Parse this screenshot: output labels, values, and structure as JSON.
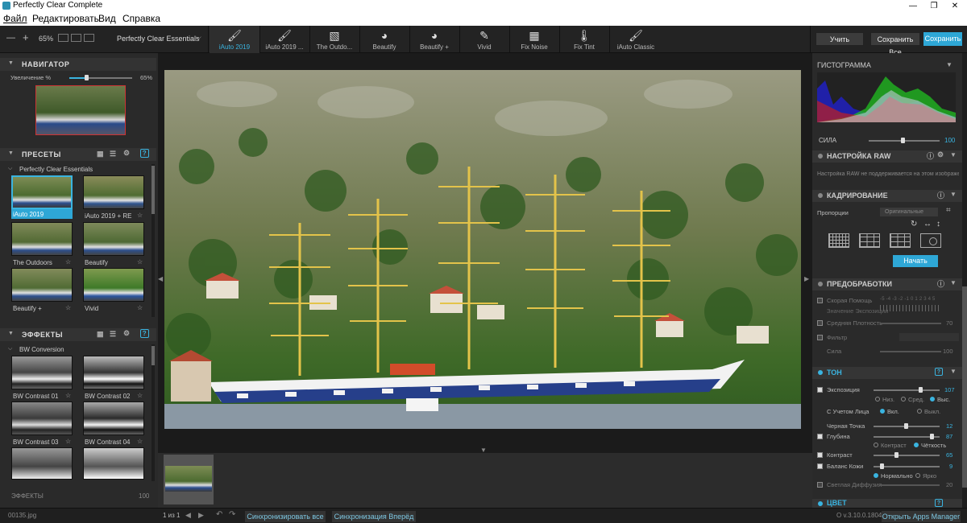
{
  "window": {
    "title": "Perfectly Clear Complete",
    "minimize": "—",
    "maximize": "❐",
    "close": "✕"
  },
  "menu": [
    {
      "label": "Файл"
    },
    {
      "label": "Редактировать"
    },
    {
      "label": "Вид"
    },
    {
      "label": "Справка"
    }
  ],
  "toolbar": {
    "zoom": "65%",
    "minus": "—",
    "plus": "+",
    "preset_selector": "Perfectly Clear Essentials",
    "presets": [
      {
        "label": "iAuto 2019",
        "badge": "2019",
        "active": true
      },
      {
        "label": "iAuto 2019 ...",
        "badge": "2019",
        "active": false
      },
      {
        "label": "The Outdo...",
        "badge": "",
        "active": false
      },
      {
        "label": "Beautify",
        "badge": "",
        "active": false
      },
      {
        "label": "Beautify +",
        "badge": "",
        "active": false
      },
      {
        "label": "Vivid",
        "badge": "",
        "active": false
      },
      {
        "label": "Fix Noise",
        "badge": "",
        "active": false
      },
      {
        "label": "Fix Tint",
        "badge": "",
        "active": false
      },
      {
        "label": "iAuto Classic",
        "badge": "HD",
        "active": false
      }
    ],
    "apply": "Учить",
    "save_all": "Сохранить Все",
    "save": "Сохранить"
  },
  "navigator": {
    "title": "НАВИГАТОР",
    "zoom_label": "Увеличение %",
    "zoom_value": "65%",
    "zoom_level": 0.27
  },
  "presets_panel": {
    "title": "ПРЕСЕТЫ",
    "group": "Perfectly Clear Essentials",
    "items": [
      {
        "label": "iAuto 2019",
        "selected": true
      },
      {
        "label": "iAuto 2019 + RE",
        "selected": false
      },
      {
        "label": "The Outdoors",
        "selected": false
      },
      {
        "label": "Beautify",
        "selected": false
      },
      {
        "label": "Beautify +",
        "selected": false
      },
      {
        "label": "Vivid",
        "selected": false
      }
    ]
  },
  "effects_panel": {
    "title": "ЭФФЕКТЫ",
    "group": "BW Conversion",
    "items": [
      {
        "label": "BW Contrast 01"
      },
      {
        "label": "BW Contrast 02"
      },
      {
        "label": "BW Contrast 03"
      },
      {
        "label": "BW Contrast 04"
      }
    ],
    "footer_label": "ЭФФЕКТЫ",
    "footer_value": "100"
  },
  "right": {
    "histogram_title": "ГИСТОГРАММА",
    "strength_label": "СИЛА",
    "strength_value": "100",
    "raw": {
      "title": "НАСТРОЙКА RAW",
      "message": "Настройка RAW не поддерживается на этом изображени..."
    },
    "crop": {
      "title": "КАДРИРОВАНИЕ",
      "proportions_label": "Пропорции",
      "proportions_value": "Оригинальные",
      "start": "Начать"
    },
    "preprocessing": {
      "title": "ПРЕДОБРАБОТКИ",
      "quick_help": "Скорая Помощь",
      "exposure_value_label": "Значение Экспозиции",
      "scale": "-5 -4 -3 -2 -1 0 1 2 3 4 5",
      "avg_density": "Средняя Плотность",
      "avg_density_value": "70",
      "filter": "Фильтр",
      "strength": "Сила",
      "strength_value": "100"
    },
    "tone": {
      "title": "ТОН",
      "exposure": "Экспозиция",
      "exposure_value": "107",
      "opt_low": "Низ.",
      "opt_mid": "Сред.",
      "opt_high": "Выс.",
      "face_aware": "С Учетом Лица",
      "on": "Вкл.",
      "off": "Выкл.",
      "black_point": "Черная Точка",
      "black_point_value": "12",
      "depth": "Глубина",
      "depth_value": "87",
      "contrast_opt": "Контраст",
      "clarity_opt": "Чёткость",
      "contrast": "Контраст",
      "contrast_value": "65",
      "skin_balance": "Баланс Кожи",
      "skin_balance_value": "9",
      "normal": "Нормально",
      "bright": "Ярко",
      "light_diffusion": "Светлая Диффузия",
      "light_diffusion_value": "20"
    },
    "color_title": "ЦВЕТ"
  },
  "status": {
    "filename": "00135.jpg",
    "pages": "1 из 1",
    "sync_all": "Синхронизировать все",
    "sync_forward": "Синхронизация Вперёд",
    "version": "O v.3.10.0.1804",
    "apps_manager": "Открыть Apps Manager"
  },
  "colors": {
    "accent": "#2ea7d6",
    "panel": "#2a2a2a",
    "toolbar": "#232323"
  }
}
